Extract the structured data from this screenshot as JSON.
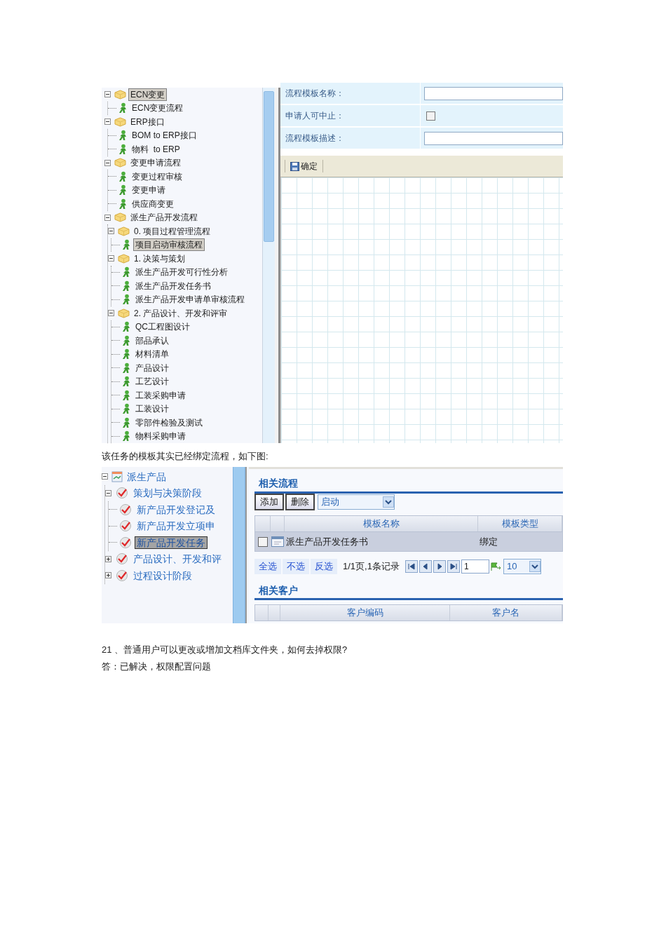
{
  "screenshot_1": {
    "tree": {
      "items": [
        {
          "kind": "folder",
          "label": "ECN变更",
          "selected": true,
          "expanded": true,
          "children": [
            {
              "kind": "process",
              "label": "ECN变更流程",
              "selected": false
            }
          ]
        },
        {
          "kind": "folder",
          "label": "ERP接口",
          "selected": false,
          "expanded": true,
          "children": [
            {
              "kind": "process",
              "label": "BOM to ERP接口",
              "selected": false
            },
            {
              "kind": "process",
              "label": "物料  to ERP",
              "selected": false
            }
          ]
        },
        {
          "kind": "folder",
          "label": "变更申请流程",
          "selected": false,
          "expanded": true,
          "children": [
            {
              "kind": "process",
              "label": "变更过程审核",
              "selected": false
            },
            {
              "kind": "process",
              "label": "变更申请",
              "selected": false
            },
            {
              "kind": "process",
              "label": "供应商变更",
              "selected": false
            }
          ]
        },
        {
          "kind": "folder",
          "label": "派生产品开发流程",
          "selected": false,
          "expanded": true,
          "children": [
            {
              "kind": "folder",
              "label": "0. 项目过程管理流程",
              "selected": false,
              "expanded": true,
              "children": [
                {
                  "kind": "process",
                  "label": "项目启动审核流程",
                  "selected": true
                }
              ]
            },
            {
              "kind": "folder",
              "label": "1. 决策与策划",
              "selected": false,
              "expanded": true,
              "children": [
                {
                  "kind": "process",
                  "label": "派生产品开发可行性分析",
                  "selected": false
                },
                {
                  "kind": "process",
                  "label": "派生产品开发任务书",
                  "selected": false
                },
                {
                  "kind": "process",
                  "label": "派生产品开发申请单审核流程",
                  "selected": false
                }
              ]
            },
            {
              "kind": "folder",
              "label": "2. 产品设计、开发和评审",
              "selected": false,
              "expanded": true,
              "children": [
                {
                  "kind": "process",
                  "label": "QC工程图设计",
                  "selected": false
                },
                {
                  "kind": "process",
                  "label": "部品承认",
                  "selected": false
                },
                {
                  "kind": "process",
                  "label": "材料清单",
                  "selected": false
                },
                {
                  "kind": "process",
                  "label": "产品设计",
                  "selected": false
                },
                {
                  "kind": "process",
                  "label": "工艺设计",
                  "selected": false
                },
                {
                  "kind": "process",
                  "label": "工装采购申请",
                  "selected": false
                },
                {
                  "kind": "process",
                  "label": "工装设计",
                  "selected": false
                },
                {
                  "kind": "process",
                  "label": "零部件检验及测试",
                  "selected": false
                },
                {
                  "kind": "process",
                  "label": "物料采购申请",
                  "selected": false
                }
              ]
            }
          ]
        }
      ]
    },
    "form": {
      "fields": [
        {
          "kind": "text",
          "label": "流程模板名称："
        },
        {
          "kind": "checkbox",
          "label": "申请人可中止：",
          "checked": false
        },
        {
          "kind": "text",
          "label": "流程模板描述："
        }
      ]
    },
    "toolbar": {
      "buttons": [
        "确定"
      ]
    }
  },
  "caption": "该任务的模板其实已经绑定流程，如下图:",
  "screenshot_2": {
    "tree": {
      "items": [
        {
          "kind": "product",
          "label": "派生产品",
          "selected": false,
          "expanded": true,
          "children": [
            {
              "kind": "stage",
              "label": "策划与决策阶段",
              "selected": false,
              "expanded": true,
              "children": [
                {
                  "kind": "task",
                  "label": "新产品开发登记及",
                  "selected": false
                },
                {
                  "kind": "task",
                  "label": "新产品开发立项申",
                  "selected": false
                },
                {
                  "kind": "task",
                  "label": "新产品开发任务",
                  "selected": true
                }
              ]
            },
            {
              "kind": "stage",
              "label": "产品设计、开发和评",
              "selected": false,
              "expanded": false
            },
            {
              "kind": "stage",
              "label": "过程设计阶段",
              "selected": false,
              "expanded": false
            }
          ]
        }
      ]
    },
    "related_processes": {
      "title": "相关流程",
      "buttons": [
        "添加",
        "删除"
      ],
      "filter": {
        "value": "启动"
      },
      "table": {
        "columns": [
          "模板名称",
          "模板类型"
        ],
        "rows": [
          {
            "checked": false,
            "cells": [
              "派生产品开发任务书",
              "绑定"
            ]
          }
        ]
      },
      "pager": {
        "selection_links": [
          "全选",
          "不选",
          "反选"
        ],
        "summary": "1/1页,1条记录",
        "page": "1",
        "page_size": "10"
      }
    },
    "related_customers": {
      "title": "相关客户",
      "table": {
        "columns": [
          "客户编码",
          "客户名"
        ]
      }
    }
  },
  "question": "21 、普通用户可以更改或增加文档库文件夹，如何去掉权限?",
  "answer": "答：已解决，权限配置问题"
}
